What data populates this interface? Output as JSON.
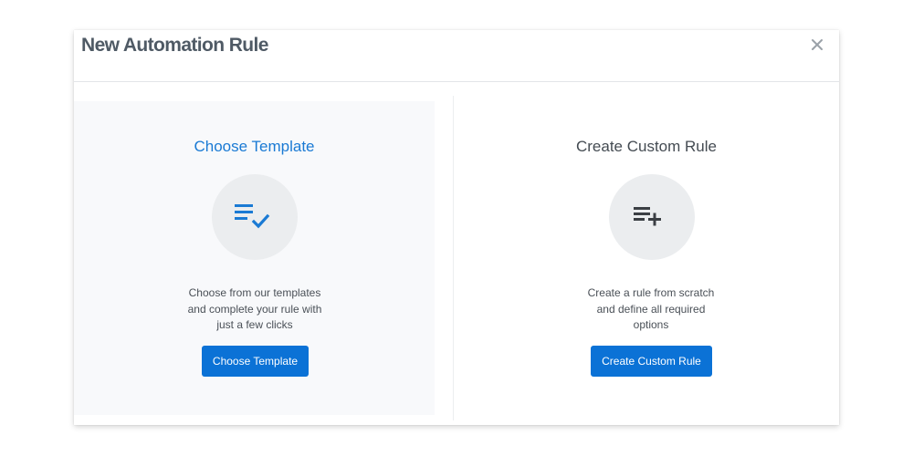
{
  "dialog": {
    "title": "New Automation Rule",
    "close_icon": "close-icon"
  },
  "template_option": {
    "heading": "Choose Template",
    "icon": "list-check-icon",
    "description_lines": [
      "Choose from our templates",
      "and complete your rule with",
      "just a few clicks"
    ],
    "button_label": "Choose Template",
    "heading_color": "#1a7ad4"
  },
  "custom_option": {
    "heading": "Create Custom Rule",
    "icon": "list-add-icon",
    "description_lines": [
      "Create a rule from scratch",
      "and define all required",
      "options"
    ],
    "button_label": "Create Custom Rule",
    "heading_color": "#444b52"
  },
  "colors": {
    "accent": "#0b72d6",
    "selected_panel_bg": "#f8f9fb",
    "icon_circle_bg": "#ebedef"
  }
}
